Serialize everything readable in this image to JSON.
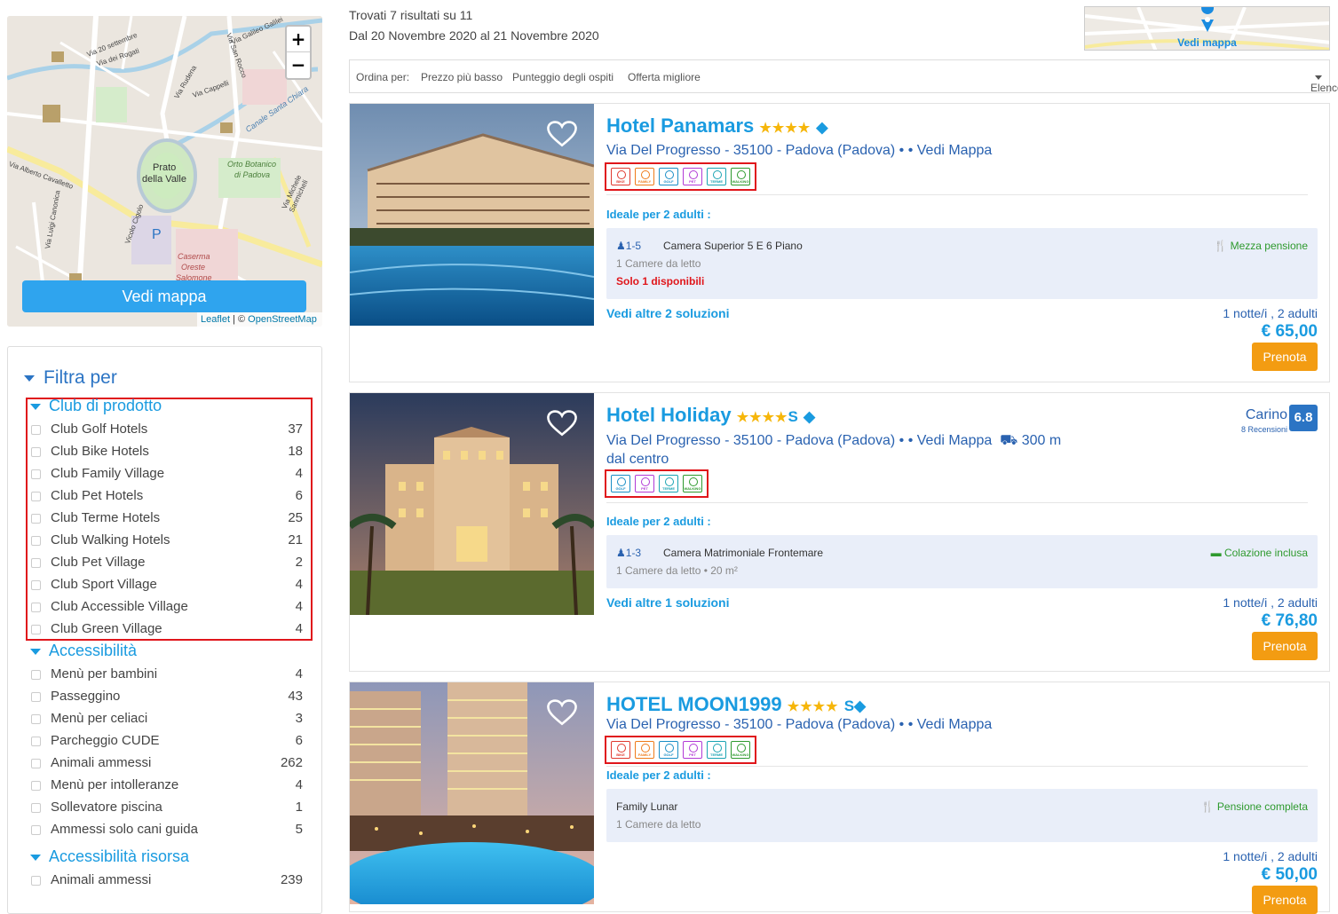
{
  "map": {
    "zoom_in": "+",
    "zoom_out": "−",
    "button_label": "Vedi mappa",
    "attribution_leaflet": "Leaflet",
    "attribution_sep": " | © ",
    "attribution_osm": "OpenStreetMap",
    "labels": [
      "Via 20 settembre",
      "Via dei Rogati",
      "Via Galileo Galilei",
      "Via San Rocco",
      "Via Rudena",
      "Via Cappelli",
      "Via Alberto Cavalletto",
      "Prato",
      "della Valle",
      "Orto Botanico",
      "di Padova",
      "Caserma",
      "Oreste",
      "Salomone",
      "Via Luigi Canonica",
      "Vicolo Cigolo",
      "Via Michele Sanmicheli",
      "Canale Santa Chiara",
      "P"
    ]
  },
  "filter": {
    "title": "Filtra per",
    "sections": [
      {
        "title": "Club di prodotto",
        "items": [
          {
            "label": "Club Golf Hotels",
            "count": "37"
          },
          {
            "label": "Club Bike Hotels",
            "count": "18"
          },
          {
            "label": "Club Family Village",
            "count": "4"
          },
          {
            "label": "Club Pet Hotels",
            "count": "6"
          },
          {
            "label": "Club Terme Hotels",
            "count": "25"
          },
          {
            "label": "Club Walking Hotels",
            "count": "21"
          },
          {
            "label": "Club Pet Village",
            "count": "2"
          },
          {
            "label": "Club Sport Village",
            "count": "4"
          },
          {
            "label": "Club Accessible Village",
            "count": "4"
          },
          {
            "label": "Club Green Village",
            "count": "4"
          }
        ]
      },
      {
        "title": "Accessibilità",
        "items": [
          {
            "label": "Menù per bambini",
            "count": "4"
          },
          {
            "label": "Passeggino",
            "count": "43"
          },
          {
            "label": "Menù per celiaci",
            "count": "3"
          },
          {
            "label": "Parcheggio CUDE",
            "count": "6"
          },
          {
            "label": "Animali ammessi",
            "count": "262"
          },
          {
            "label": "Menù per intolleranze",
            "count": "4"
          },
          {
            "label": "Sollevatore piscina",
            "count": "1"
          },
          {
            "label": "Ammessi solo cani guida",
            "count": "5"
          }
        ]
      },
      {
        "title": "Accessibilità risorsa",
        "items": [
          {
            "label": "Animali ammessi",
            "count": "239"
          }
        ]
      }
    ]
  },
  "results": {
    "found": "Trovati 7 risultati su 11",
    "dates": "Dal 20 Novembre 2020 al 21 Novembre 2020",
    "minimap_label": "Vedi mappa"
  },
  "sort": {
    "label": "Ordina per:",
    "options": [
      "Prezzo più basso",
      "Punteggio degli ospiti",
      "Offerta migliore"
    ],
    "view": "Elenco"
  },
  "icon_labels": {
    "bike": "BIKE",
    "family": "FAMILY",
    "golf": "GOLF",
    "pet": "PET",
    "terme": "TERME",
    "walking": "WALKING"
  },
  "colors": {
    "bike": "#e03a2f",
    "family": "#ef7b1a",
    "golf": "#1a8ec6",
    "pet": "#b23ad6",
    "terme": "#1aa3b3",
    "walking": "#2e9a2e",
    "accent": "#1a9be0",
    "book": "#f39c12"
  },
  "hotels": [
    {
      "name": "Hotel Panamars",
      "stars": "★★★★",
      "superior": "",
      "address": "Via Del Progresso - 35100 - Padova (Padova) • • Vedi Mappa",
      "ideal": "Ideale per 2 adulti :",
      "room_guests": "1-5",
      "room_name": "Camera Superior 5 E 6 Piano",
      "room_detail": "1 Camere da letto",
      "room_alert": "Solo 1 disponibili",
      "meal": "Mezza pensione",
      "more": "Vedi altre 2 soluzioni",
      "nights": "1 notte/i , 2 adulti",
      "price": "€ 65,00",
      "book": "Prenota"
    },
    {
      "name": "Hotel Holiday",
      "stars": "★★★★",
      "superior": "S",
      "address": "Via Del Progresso - 35100 - Padova (Padova) • • Vedi Mappa",
      "distance": "300 m",
      "distance2": "dal centro",
      "review_word": "Carino",
      "review_count": "8 Recensioni",
      "score": "6.8",
      "ideal": "Ideale per 2 adulti :",
      "room_guests": "1-3",
      "room_name": "Camera Matrimoniale Frontemare",
      "room_detail": "1 Camere da letto • 20 m²",
      "meal": "Colazione inclusa",
      "more": "Vedi altre 1 soluzioni",
      "nights": "1 notte/i , 2 adulti",
      "price": "€ 76,80",
      "book": "Prenota"
    },
    {
      "name": "HOTEL MOON1999",
      "stars": "★★★★",
      "superior": "S",
      "address": "Via Del Progresso - 35100 - Padova (Padova) • • Vedi Mappa",
      "ideal": "Ideale per 2 adulti :",
      "room_name": "Family Lunar",
      "room_detail": "1 Camere da letto",
      "meal": "Pensione completa",
      "nights": "1 notte/i , 2 adulti",
      "price": "€ 50,00",
      "book": "Prenota"
    }
  ]
}
